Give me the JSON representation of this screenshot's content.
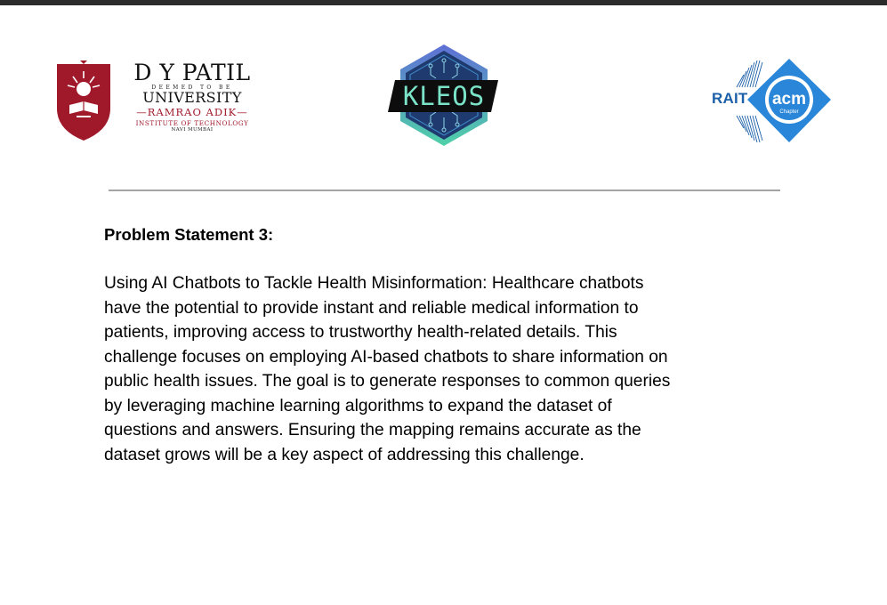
{
  "logos": {
    "dy_patil": {
      "name": "D Y PATIL",
      "deemed": "DEEMED TO BE",
      "university": "UNIVERSITY",
      "ramrao": "—RAMRAO ADIK—",
      "institute": "INSTITUTE OF TECHNOLOGY",
      "location": "NAVI MUMBAI",
      "colors": {
        "crest": "#a0192b",
        "text": "#111111"
      }
    },
    "kleos": {
      "text": "KLEOS",
      "colors": {
        "text": "#7be3c8",
        "hexagon_outer": "#6a7bd8",
        "hexagon_inner": "#1f3a6e",
        "band": "#0d0d0d"
      }
    },
    "acm": {
      "rait": "RAIT",
      "acm": "acm",
      "chapter": "Chapter",
      "colors": {
        "primary": "#1b5fa8",
        "diamond": "#2a86d8"
      }
    }
  },
  "content": {
    "heading": "Problem Statement 3:",
    "body_lines": [
      "Using AI Chatbots to Tackle Health Misinformation: Healthcare chatbots",
      "have the potential to provide instant and reliable medical information to",
      "patients, improving access to trustworthy health-related details. This",
      "challenge focuses on employing AI-based chatbots to share information on",
      "public health issues. The goal is to generate responses to common queries",
      "by leveraging machine learning algorithms to expand the dataset of",
      "questions and answers. Ensuring the mapping remains accurate as the",
      "dataset grows will be a key aspect of addressing this challenge."
    ]
  }
}
